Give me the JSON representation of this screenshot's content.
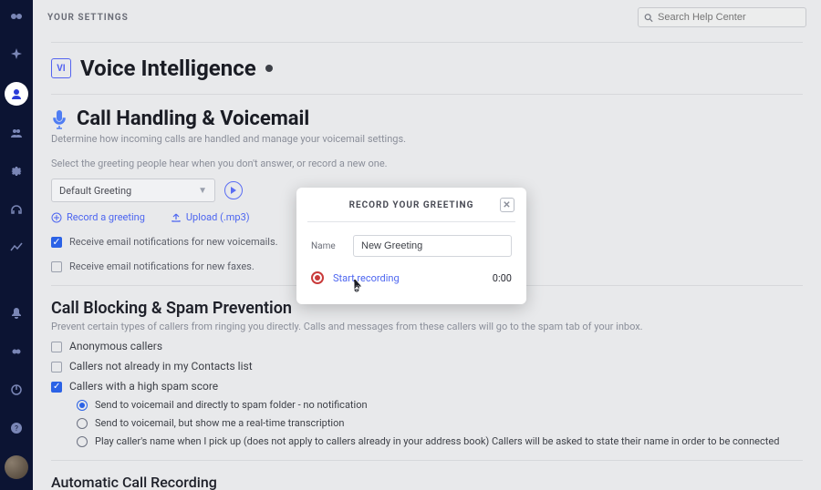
{
  "topbar": {
    "crumb": "YOUR SETTINGS",
    "search_placeholder": "Search Help Center"
  },
  "vi": {
    "badge": "VI",
    "title": "Voice Intelligence"
  },
  "voicemail": {
    "title": "Call Handling & Voicemail",
    "subtitle": "Determine how incoming calls are handled and manage your voicemail settings.",
    "greet_hint": "Select the greeting people hear when you don't answer, or record a new one.",
    "select_value": "Default Greeting",
    "record_link": "Record a greeting",
    "upload_link": "Upload (.mp3)",
    "chk_email_vm": "Receive email notifications for new voicemails.",
    "chk_email_fax": "Receive email notifications for new faxes."
  },
  "blocking": {
    "title": "Call Blocking & Spam Prevention",
    "subtitle": "Prevent certain types of callers from ringing you directly. Calls and messages from these callers will go to the spam tab of your inbox.",
    "opt_anon": "Anonymous callers",
    "opt_contacts": "Callers not already in my Contacts list",
    "opt_spam": "Callers with a high spam score",
    "sub_a": "Send to voicemail and directly to spam folder - no notification",
    "sub_b": "Send to voicemail, but show me a real-time transcription",
    "sub_c": "Play caller's name when I pick up (does not apply to callers already in your address book) Callers will be asked to state their name in order to be connected"
  },
  "auto_rec": {
    "title": "Automatic Call Recording"
  },
  "modal": {
    "title": "RECORD YOUR GREETING",
    "name_label": "Name",
    "name_value": "New Greeting",
    "start": "Start recording",
    "time": "0:00"
  }
}
